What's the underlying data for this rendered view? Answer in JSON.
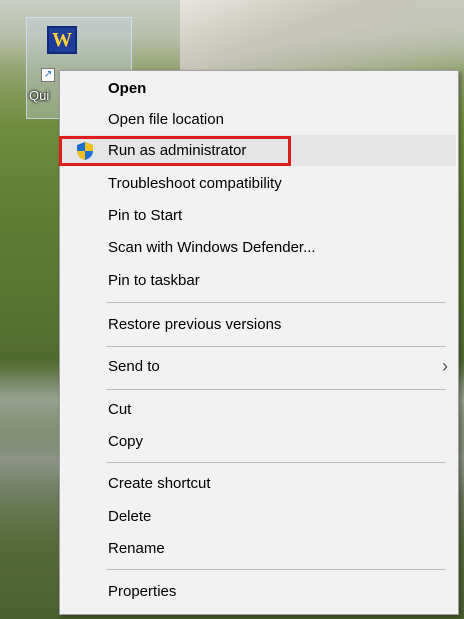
{
  "desktop": {
    "shortcut": {
      "label": "Qui",
      "icon": "word-shortcut-icon"
    }
  },
  "context_menu": {
    "items": [
      {
        "label": "Open",
        "bold": true
      },
      {
        "label": "Open file location"
      },
      {
        "label": "Run as administrator",
        "icon": "uac-shield-icon",
        "highlighted": true
      },
      {
        "label": "Troubleshoot compatibility"
      },
      {
        "label": "Pin to Start"
      },
      {
        "label": "Scan with Windows Defender..."
      },
      {
        "label": "Pin to taskbar"
      },
      {
        "label": "Restore previous versions"
      },
      {
        "label": "Send to",
        "submenu": true
      },
      {
        "label": "Cut"
      },
      {
        "label": "Copy"
      },
      {
        "label": "Create shortcut"
      },
      {
        "label": "Delete"
      },
      {
        "label": "Rename"
      },
      {
        "label": "Properties"
      }
    ],
    "submenu_glyph": "›"
  },
  "colors": {
    "highlight_box": "#e01b1b",
    "menu_background": "#f2f2f2",
    "hover_row": "#e5e5e5"
  }
}
